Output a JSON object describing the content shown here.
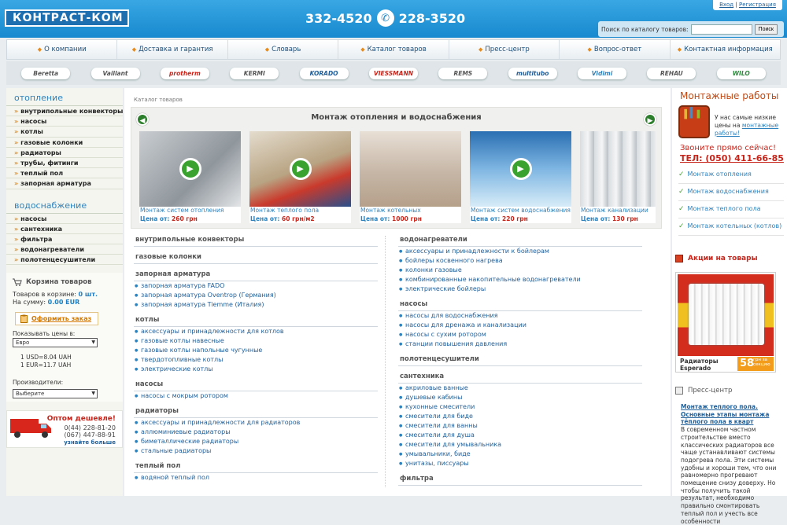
{
  "header": {
    "logo_text": "КОНТРАСТ-КОМ",
    "phone1": "332-4520",
    "phone2": "228-3520",
    "login": "Вход",
    "register": "Регистрация",
    "search_label": "Поиск по каталогу товаров:",
    "search_value": "",
    "search_button": "Поиск"
  },
  "nav": [
    "О компании",
    "Доставка и гарантия",
    "Словарь",
    "Каталог товаров",
    "Пресс-центр",
    "Вопрос-ответ",
    "Контактная информация"
  ],
  "brands": [
    "Beretta",
    "Vaillant",
    "protherm",
    "KERMI",
    "KORADO",
    "VIESSMANN",
    "REMS",
    "multitubo",
    "Vidimi",
    "REHAU",
    "WILO"
  ],
  "sidebar": {
    "heating_title": "отопление",
    "heating_items": [
      "внутрипольные конвекторы",
      "насосы",
      "котлы",
      "газовые колонки",
      "радиаторы",
      "трубы, фитинги",
      "теплый пол",
      "запорная арматура"
    ],
    "water_title": "водоснабжение",
    "water_items": [
      "насосы",
      "сантехника",
      "фильтра",
      "водонагреватели",
      "полотенцесушители"
    ],
    "cart": {
      "title": "Корзина товаров",
      "in_cart_label": "Товаров в корзине:",
      "in_cart_value": "0 шт.",
      "sum_label": "На сумму:",
      "sum_value": "0.00 EUR",
      "order_button": "Оформить заказ",
      "currency_label": "Показывать цены в:",
      "currency_selected": "Евро",
      "rate1": "1 USD=8.04 UAH",
      "rate2": "1 EUR=11.7 UAH",
      "producers_label": "Производители:",
      "producers_selected": "Выберите"
    },
    "wholesale": {
      "title": "Оптом дешевле!",
      "phone1": "0(44) 228-81-20",
      "phone2": "(067) 447-88-91",
      "more": "узнайте больше"
    }
  },
  "center": {
    "breadcrumb": "Каталог товаров",
    "slider_title": "Монтаж отопления и водоснабжения",
    "price_label": "Цена от:",
    "slides": [
      {
        "caption": "Монтаж систем отопления",
        "price": "260 грн"
      },
      {
        "caption": "Монтаж теплого пола",
        "price": "60 грн/м2"
      },
      {
        "caption": "Монтаж котельных",
        "price": "1000 грн"
      },
      {
        "caption": "Монтаж систем водоснабжения",
        "price": "220 грн"
      },
      {
        "caption": "Монтаж канализации",
        "price": "130 грн"
      }
    ],
    "left_sections": [
      {
        "title": "внутрипольные конвекторы",
        "items": []
      },
      {
        "title": "газовые колонки",
        "items": []
      },
      {
        "title": "запорная арматура",
        "items": [
          "запорная арматура FADO",
          "запорная арматура Oventrop (Германия)",
          "запорная арматура Tiemme (Италия)"
        ]
      },
      {
        "title": "котлы",
        "items": [
          "аксессуары и принадлежности для котлов",
          "газовые котлы навесные",
          "газовые котлы напольные чугунные",
          "твердотопливные котлы",
          "электрические котлы"
        ]
      },
      {
        "title": "насосы",
        "items": [
          "насосы с мокрым ротором"
        ]
      },
      {
        "title": "радиаторы",
        "items": [
          "аксессуары и принадлежности для радиаторов",
          "аллюминиевые радиаторы",
          "биметаллические радиаторы",
          "стальные радиаторы"
        ]
      },
      {
        "title": "теплый пол",
        "items": [
          "водяной теплый пол"
        ]
      }
    ],
    "right_sections": [
      {
        "title": "водонагреватели",
        "items": [
          "аксессуары и принадлежности к бойлерам",
          "бойлеры косвенного нагрева",
          "колонки газовые",
          "комбинированные накопительные водонагреватели",
          "электрические бойлеры"
        ]
      },
      {
        "title": "насосы",
        "items": [
          "насосы для водоснабжения",
          "насосы для дренажа и канализации",
          "насосы с сухим ротором",
          "станции повышения давления"
        ]
      },
      {
        "title": "полотенцесушители",
        "items": []
      },
      {
        "title": "сантехника",
        "items": [
          "акриловые ванные",
          "душевые кабины",
          "кухонные смесители",
          "смесители для биде",
          "смесители для ванны",
          "смесители для душа",
          "смесители для умывальника",
          "умывальники, биде",
          "унитазы, писсуары"
        ]
      },
      {
        "title": "фильтра",
        "items": []
      }
    ]
  },
  "right": {
    "mont_title": "Монтажные работы",
    "mont_text": "У нас самые низкие цены на",
    "mont_link": "монтажные работы!",
    "call": "Звоните прямо сейчас!",
    "tel": "ТЕЛ: (050) 411-66-85",
    "mont_items": [
      "Монтаж отопления",
      "Монтаж водоснабжения",
      "Монтаж теплого пола",
      "Монтаж котельных (котлов)"
    ],
    "promo_title": "Акции на товары",
    "promo_name_1": "Радиаторы",
    "promo_name_2": "Esperado",
    "promo_price": "58",
    "promo_price_unit": "грн за секцию",
    "press_title": "Пресс-центр",
    "press_link": "Монтаж теплого пола. Основные этапы монтажа тёплого пола в кварт",
    "press_text": "В современном частном строительстве вместо классических радиаторов все чаще устанавливают системы подогрева пола. Эти системы удобны и хороши тем, что они равномерно прогревают помещение снизу доверху. Но чтобы получить такой результат, необходимо правильно смонтировать теплый пол и учесть все особенности"
  },
  "colors": {
    "accent": "#2e83bf",
    "header": "#1889cf",
    "red": "#c7261c",
    "orange": "#e78b1c"
  }
}
